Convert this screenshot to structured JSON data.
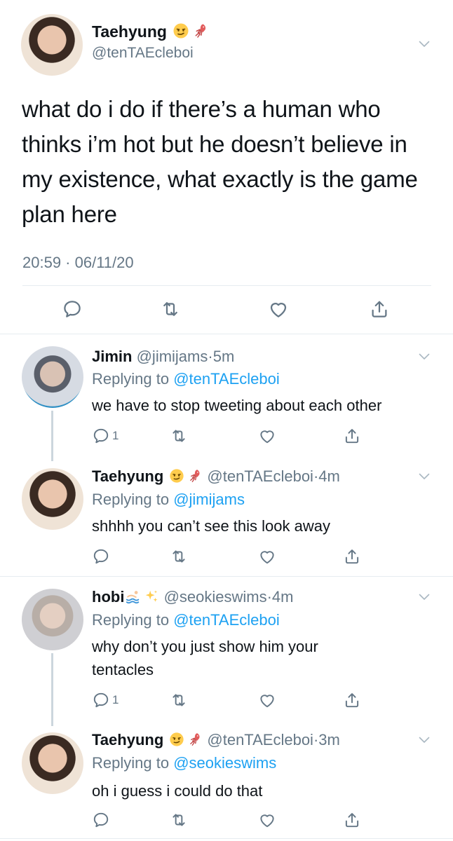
{
  "main_tweet": {
    "name": "Taehyung",
    "handle": "@tenTAEcleboi",
    "text": "what do i do if there’s a human who thinks i’m hot but he doesn’t believe in my existence, what exactly is the game plan here",
    "timestamp": "20:59 · 06/11/20",
    "icons": [
      "reply-icon",
      "retweet-icon",
      "like-icon",
      "share-icon"
    ]
  },
  "replies": [
    {
      "name": "Jimin",
      "handle": "@jimijams",
      "sep": "·",
      "time": "5m",
      "replying_label": "Replying to",
      "replying_to": "@tenTAEcleboi",
      "text": "we have to stop tweeting about each other",
      "reply_count": "1"
    },
    {
      "name": "Taehyung",
      "handle": "@tenTAEcleboi",
      "sep": "·",
      "time": "4m",
      "replying_label": "Replying to",
      "replying_to": "@jimijams",
      "text": "shhhh you can’t see this look away",
      "reply_count": ""
    },
    {
      "name": "hobi",
      "handle": "@seokieswims",
      "sep": "·",
      "time": "4m",
      "replying_label": "Replying to",
      "replying_to": "@tenTAEcleboi",
      "text": "why don’t you just show him your tentacles",
      "reply_count": "1"
    },
    {
      "name": "Taehyung",
      "handle": "@tenTAEcleboi",
      "sep": "·",
      "time": "3m",
      "replying_label": "Replying to",
      "replying_to": "@seokieswims",
      "text": "oh i guess i could do that",
      "reply_count": ""
    }
  ],
  "colors": {
    "text": "#0f1419",
    "secondary": "#657786",
    "link": "#1da1f2",
    "divider": "#e6ecf0"
  }
}
